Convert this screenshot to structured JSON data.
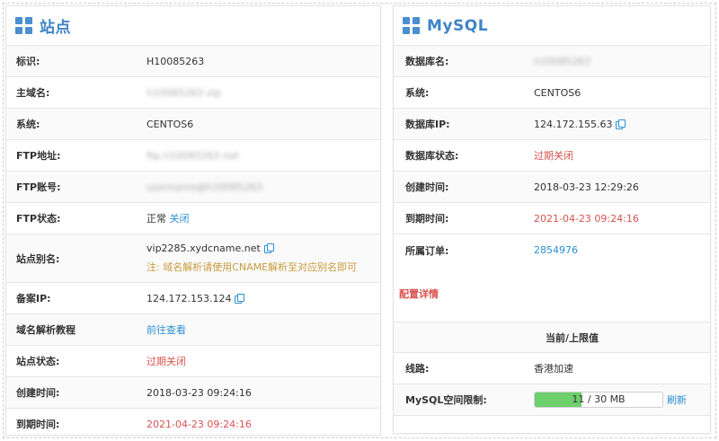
{
  "site": {
    "title": "站点",
    "rows": [
      {
        "label": "标识:",
        "value": "H10085263"
      },
      {
        "label": "主域名:",
        "value": "h10085263.vip"
      },
      {
        "label": "系统:",
        "value": "CENTOS6"
      },
      {
        "label": "FTP地址:",
        "value": "ftp.h10085263.net"
      },
      {
        "label": "FTP账号:",
        "value": "username@h10085263"
      },
      {
        "label": "FTP状态:",
        "value": "正常",
        "action": "关闭"
      },
      {
        "label": "站点别名:",
        "value": "vip2285.xydcname.net",
        "note": "注: 域名解析请使用CNAME解析至对应别名即可"
      },
      {
        "label": "备案IP:",
        "value": "124.172.153.124"
      },
      {
        "label": "域名解析教程",
        "value": "前往查看"
      },
      {
        "label": "站点状态:",
        "value": "过期关闭"
      },
      {
        "label": "创建时间:",
        "value": "2018-03-23 09:24:16"
      },
      {
        "label": "到期时间:",
        "value": "2021-04-23 09:24:16"
      }
    ]
  },
  "mysql": {
    "title": "MySQL",
    "rows": [
      {
        "label": "数据库名:",
        "value": "h10085263"
      },
      {
        "label": "系统:",
        "value": "CENTOS6"
      },
      {
        "label": "数据库IP:",
        "value": "124.172.155.63"
      },
      {
        "label": "数据库状态:",
        "value": "过期关闭"
      },
      {
        "label": "创建时间:",
        "value": "2018-03-23 12:29:26"
      },
      {
        "label": "到期时间:",
        "value": "2021-04-23 09:24:16"
      },
      {
        "label": "所属订单:",
        "value": "2854976"
      }
    ],
    "config": {
      "title": "配置详情",
      "header": "当前/上限值",
      "line_label": "线路:",
      "line_value": "香港加速",
      "space_label": "MySQL空间限制:",
      "space_text": "11 / 30 MB",
      "space_used_fraction": 0.3667,
      "refresh": "刷新"
    }
  },
  "colors": {
    "accent": "#3f84c6",
    "link": "#2a8fd4",
    "danger": "#d9534f",
    "note": "#c99a3c",
    "progress": "#6ccf6c"
  }
}
